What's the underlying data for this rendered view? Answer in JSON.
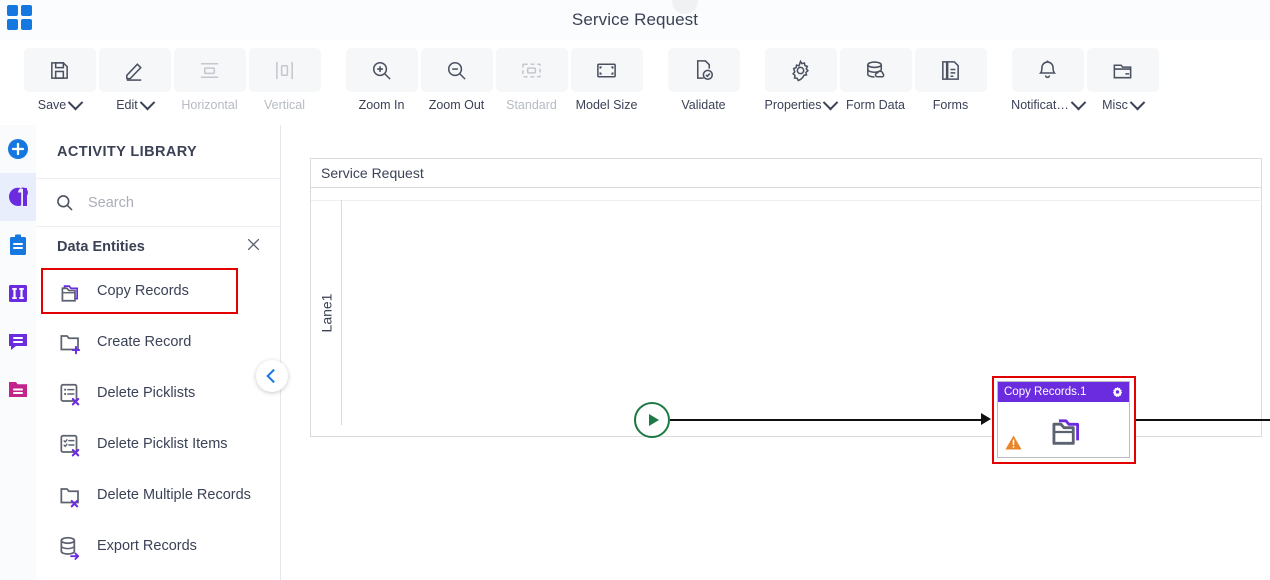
{
  "titlebar": {
    "title": "Service Request",
    "logo_icon": "grid-apps-icon"
  },
  "toolbar": {
    "buttons": [
      {
        "id": "save",
        "label": "Save",
        "icon": "floppy-save-icon",
        "caret": true,
        "disabled": false
      },
      {
        "id": "edit",
        "label": "Edit",
        "icon": "pencil-edit-icon",
        "caret": true,
        "disabled": false
      },
      {
        "id": "horizontal",
        "label": "Horizontal",
        "icon": "align-horizontal-icon",
        "caret": false,
        "disabled": true
      },
      {
        "id": "vertical",
        "label": "Vertical",
        "icon": "align-vertical-icon",
        "caret": false,
        "disabled": true
      },
      {
        "id": "zoom-in",
        "label": "Zoom In",
        "icon": "zoom-in-icon",
        "caret": false,
        "disabled": false
      },
      {
        "id": "zoom-out",
        "label": "Zoom Out",
        "icon": "zoom-out-icon",
        "caret": false,
        "disabled": false
      },
      {
        "id": "standard",
        "label": "Standard",
        "icon": "standard-size-icon",
        "caret": false,
        "disabled": true
      },
      {
        "id": "model-size",
        "label": "Model Size",
        "icon": "model-size-icon",
        "caret": false,
        "disabled": false
      },
      {
        "id": "validate",
        "label": "Validate",
        "icon": "validate-check-icon",
        "caret": false,
        "disabled": false
      },
      {
        "id": "properties",
        "label": "Properties",
        "icon": "gear-icon",
        "caret": true,
        "disabled": false
      },
      {
        "id": "form-data",
        "label": "Form Data",
        "icon": "database-cloud-icon",
        "caret": false,
        "disabled": false
      },
      {
        "id": "forms",
        "label": "Forms",
        "icon": "document-copy-icon",
        "caret": false,
        "disabled": false
      },
      {
        "id": "notification",
        "label": "Notificat…",
        "icon": "bell-icon",
        "caret": true,
        "disabled": false
      },
      {
        "id": "misc",
        "label": "Misc",
        "icon": "folder-misc-icon",
        "caret": true,
        "disabled": false
      }
    ]
  },
  "rail": {
    "items": [
      {
        "id": "add",
        "icon": "plus-circle-icon",
        "color": "#1478e0",
        "active": false
      },
      {
        "id": "process",
        "icon": "swirl-logo-icon",
        "color": "#6b2ce0",
        "active": true
      },
      {
        "id": "tasks",
        "icon": "clipboard-icon",
        "color": "#1478e0",
        "active": false
      },
      {
        "id": "columns",
        "icon": "columns-icon",
        "color": "#6b2ce0",
        "active": false
      },
      {
        "id": "comments",
        "icon": "chat-bubble-icon",
        "color": "#6b2ce0",
        "active": false
      },
      {
        "id": "documents",
        "icon": "folder-icon",
        "color": "#c2248c",
        "active": false
      }
    ]
  },
  "panel": {
    "heading": "ACTIVITY LIBRARY",
    "search": {
      "placeholder": "Search",
      "value": "",
      "icon": "search-icon"
    },
    "category": {
      "label": "Data Entities",
      "close_icon": "close-x-icon"
    },
    "collapse_icon": "chevron-left-icon",
    "activities": [
      {
        "name": "Copy Records",
        "icon": "copy-records-icon",
        "highlighted": true
      },
      {
        "name": "Create Record",
        "icon": "create-record-icon",
        "highlighted": false
      },
      {
        "name": "Delete Picklists",
        "icon": "delete-picklists-icon",
        "highlighted": false
      },
      {
        "name": "Delete Picklist Items",
        "icon": "delete-picklist-items-icon",
        "highlighted": false
      },
      {
        "name": "Delete Multiple Records",
        "icon": "delete-multiple-records-icon",
        "highlighted": false
      },
      {
        "name": "Export Records",
        "icon": "export-records-icon",
        "highlighted": false
      }
    ]
  },
  "canvas": {
    "pool_title": "Service Request",
    "lane_label": "Lane1",
    "start_event": {
      "name": "start-event",
      "icon": "play-triangle-icon",
      "color": "#1e7a44"
    },
    "end_event": {
      "name": "end-event",
      "icon": "stop-square-icon",
      "color": "#ba2424"
    },
    "task": {
      "title": "Copy Records.1",
      "header_color": "#6b2ce0",
      "selection_color": "#e30000",
      "gear_icon": "gear-icon",
      "warning_icon": "warning-triangle-icon",
      "body_icon": "copy-records-icon"
    }
  }
}
